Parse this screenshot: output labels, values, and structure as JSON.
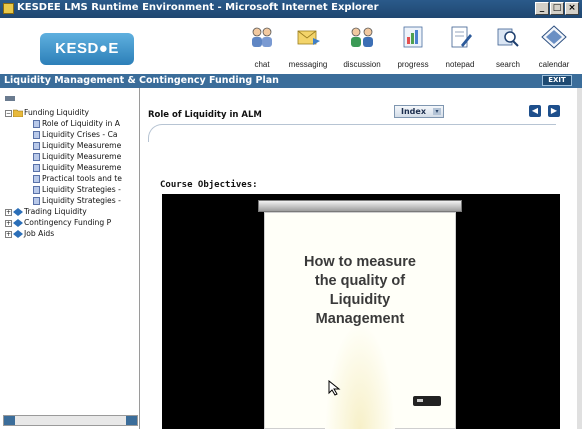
{
  "window": {
    "title": "KESDEE LMS Runtime Environment - Microsoft Internet Explorer",
    "min_glyph": "_",
    "max_glyph": "□",
    "close_glyph": "×"
  },
  "brand": {
    "logo_text": "KESD●E"
  },
  "toolbar": [
    {
      "label": "chat",
      "icon": "chat-icon"
    },
    {
      "label": "messaging",
      "icon": "messaging-icon"
    },
    {
      "label": "discussion",
      "icon": "discussion-icon"
    },
    {
      "label": "progress",
      "icon": "progress-icon"
    },
    {
      "label": "notepad",
      "icon": "notepad-icon"
    },
    {
      "label": "search",
      "icon": "search-icon"
    },
    {
      "label": "calendar",
      "icon": "calendar-icon"
    }
  ],
  "course": {
    "title": "Liquidity Management & Contingency Funding Plan",
    "exit_label": "EXIT"
  },
  "tree": {
    "root": {
      "label": "Funding Liquidity",
      "expanded": true
    },
    "children": [
      "Role of Liquidity in A",
      "Liquidity Crises - Ca",
      "Liquidity Measureme",
      "Liquidity Measureme",
      "Liquidity Measureme",
      "Practical tools and te",
      "Liquidity Strategies -",
      "Liquidity Strategies -"
    ],
    "collapsed": [
      "Trading Liquidity",
      "Contingency Funding P",
      "Job Aids"
    ],
    "plus_glyph": "+",
    "minus_glyph": "−"
  },
  "main": {
    "page_title": "Role of Liquidity in ALM",
    "index_label": "Index",
    "index_arrow": "▾",
    "prev_glyph": "◀",
    "next_glyph": "▶",
    "objectives_label": "Course Objectives:"
  },
  "video": {
    "headline_lines": [
      "How to measure",
      "the quality of",
      "Liquidity",
      "Management"
    ]
  },
  "colors": {
    "titlebar": "#1f4670",
    "coursebar": "#3b6d9a",
    "accent": "#1e4f8c"
  }
}
